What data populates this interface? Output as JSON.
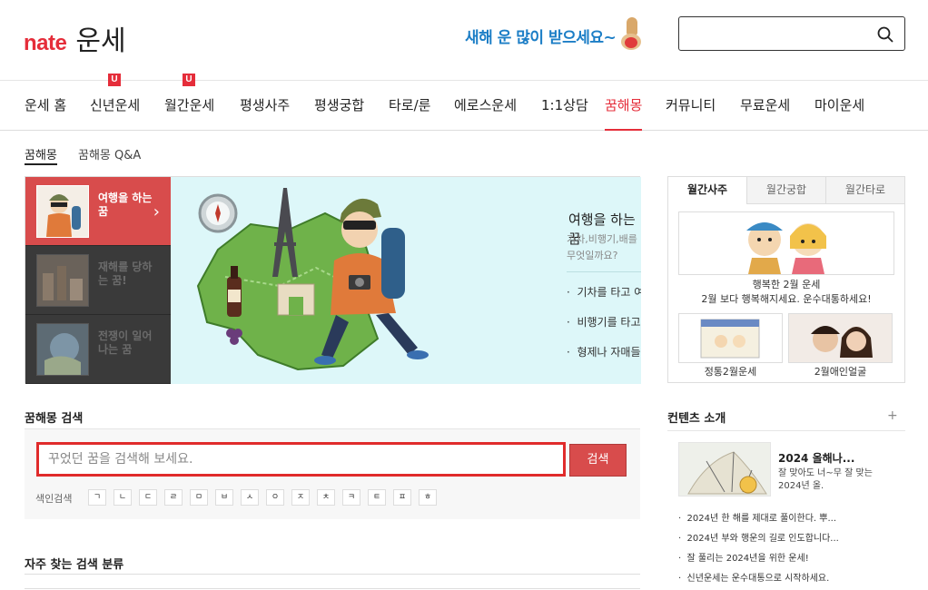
{
  "header": {
    "logo_brand": "nate",
    "logo_title": "운세",
    "banner_text": "새해 운 많이 받으세요~",
    "search_placeholder": ""
  },
  "gnb": {
    "items": [
      {
        "label": "운세 홈"
      },
      {
        "label": "신년운세",
        "badge": "U"
      },
      {
        "label": "월간운세",
        "badge": "U"
      },
      {
        "label": "평생사주"
      },
      {
        "label": "평생궁합"
      },
      {
        "label": "타로/룬"
      },
      {
        "label": "에로스운세"
      },
      {
        "label": "1:1상담"
      },
      {
        "label": "꿈해몽",
        "active": true
      },
      {
        "label": "커뮤니티"
      },
      {
        "label": "무료운세"
      },
      {
        "label": "마이운세"
      }
    ]
  },
  "subtabs": [
    "꿈해몽",
    "꿈해몽 Q&A"
  ],
  "feature": {
    "thumbs": [
      {
        "label": "여행을 하는 꿈",
        "active": true
      },
      {
        "label": "재해를 당하는 꿈!",
        "active": false
      },
      {
        "label": "전쟁이 일어나는 꿈",
        "active": false
      }
    ],
    "title": "여행을 하는 꿈",
    "desc": "기차,비행기,배를 타고 여행하는 꿈의 의미는 무엇일까요?",
    "links": [
      "기차를 타고 여행하는 ...",
      "비행기를 타고 여행하는...",
      "형제나 자매들이 모여 ..."
    ]
  },
  "dream_search": {
    "title": "꿈해몽 검색",
    "placeholder": "꾸었던 꿈을 검색해 보세요.",
    "button": "검색",
    "index_label": "색인검색",
    "index_chars": [
      "ㄱ",
      "ㄴ",
      "ㄷ",
      "ㄹ",
      "ㅁ",
      "ㅂ",
      "ㅅ",
      "ㅇ",
      "ㅈ",
      "ㅊ",
      "ㅋ",
      "ㅌ",
      "ㅍ",
      "ㅎ"
    ]
  },
  "frequent": {
    "title": "자주 찾는 검색 분류"
  },
  "side": {
    "tabs": [
      "월간사주",
      "월간궁합",
      "월간타로"
    ],
    "hero_caption": "행복한 2월 운세",
    "hero_sub": "2월 보다 행복해지세요. 운수대통하세요!",
    "small_captions": [
      "정통2월운세",
      "2월애인얼굴"
    ]
  },
  "content_intro": {
    "title": "컨텐츠 소개",
    "plus": "+",
    "card_title": "2024 올해나...",
    "card_desc": "잘 맞아도 너~무 잘 맞는 2024년 올.",
    "links": [
      "2024년 한 해를 제대로 풀이한다. 뿌...",
      "2024년 부와 행운의 길로 인도합니다...",
      "잘 풀리는 2024년을 위한 운세!",
      "신년운세는 운수대통으로 시작하세요."
    ]
  },
  "colors": {
    "brand": "#e52d3a",
    "active_thumb": "#d84c4c",
    "banner_blue": "#1c7ec6"
  }
}
